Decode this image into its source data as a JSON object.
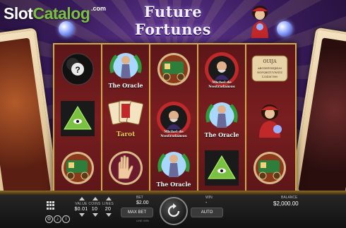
{
  "branding": {
    "watermark": "SlotCatalog",
    "watermark_parts": [
      "Slot",
      "Catalog"
    ],
    "watermark_tld": ".com"
  },
  "game": {
    "title": "Future Fortunes"
  },
  "reels": [
    [
      {
        "symbol": "magic-8-ball"
      },
      {
        "symbol": "pyramid-eye"
      },
      {
        "symbol": "gypsy-wagon"
      }
    ],
    [
      {
        "symbol": "the-oracle",
        "label": "The Oracle"
      },
      {
        "symbol": "tarot",
        "label": "Tarot"
      },
      {
        "symbol": "palm-reading"
      }
    ],
    [
      {
        "symbol": "gypsy-wagon"
      },
      {
        "symbol": "nostradamus",
        "label": "Michel de Nostradamus"
      },
      {
        "symbol": "the-oracle",
        "label": "The Oracle"
      }
    ],
    [
      {
        "symbol": "nostradamus",
        "label": "Michel de Nostradamus"
      },
      {
        "symbol": "the-oracle",
        "label": "The Oracle"
      },
      {
        "symbol": "pyramid-eye"
      }
    ],
    [
      {
        "symbol": "ouija-board",
        "label": "OUIJA ABCDEFGHIJKLMNOPQRSTUVWXYZ 1234567890"
      },
      {
        "symbol": "fortune-teller"
      },
      {
        "symbol": "gypsy-wagon"
      }
    ]
  ],
  "controls": {
    "value": {
      "label": "VALUE",
      "amount": "$0.01"
    },
    "coins": {
      "label": "COINS",
      "amount": "10"
    },
    "lines": {
      "label": "LINES",
      "amount": "20"
    },
    "bet": {
      "label": "BET",
      "amount": "$2.00"
    },
    "win": {
      "label": "WIN",
      "amount": "-"
    },
    "balance": {
      "label": "BALANCE",
      "amount": "$2,000.00"
    },
    "max_bet_label": "MAX BET",
    "auto_label": "AUTO",
    "line_win_label": "LINE WIN"
  },
  "colors": {
    "reel_bg": "#7a1e20",
    "frame_gold": "#d4a94a",
    "panel_bg": "#1a1a1a"
  }
}
